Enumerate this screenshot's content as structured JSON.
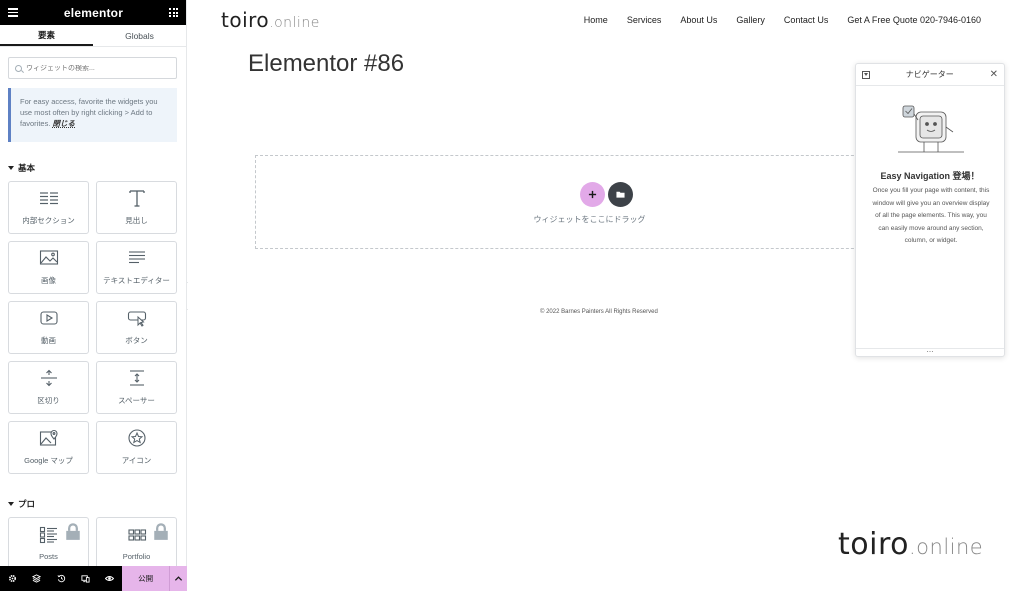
{
  "panel": {
    "brand": "elementor",
    "tabs": [
      "要素",
      "Globals"
    ],
    "search_placeholder": "ウィジェットの検索...",
    "tip": {
      "text": "For easy access, favorite the widgets you use most often by right clicking > Add to favorites.",
      "close_label": "閉じる"
    },
    "basic_section": "基本",
    "basic_widgets": [
      {
        "label": "内部セクション",
        "icon": "inner-section-icon"
      },
      {
        "label": "見出し",
        "icon": "heading-icon"
      },
      {
        "label": "画像",
        "icon": "image-icon"
      },
      {
        "label": "テキストエディター",
        "icon": "text-editor-icon"
      },
      {
        "label": "動画",
        "icon": "video-icon"
      },
      {
        "label": "ボタン",
        "icon": "button-icon"
      },
      {
        "label": "区切り",
        "icon": "divider-icon"
      },
      {
        "label": "スペーサー",
        "icon": "spacer-icon"
      },
      {
        "label": "Google マップ",
        "icon": "google-maps-icon"
      },
      {
        "label": "アイコン",
        "icon": "star-icon"
      }
    ],
    "pro_section": "プロ",
    "pro_widgets": [
      {
        "label": "Posts",
        "icon": "posts-icon",
        "locked": true
      },
      {
        "label": "Portfolio",
        "icon": "portfolio-icon",
        "locked": true
      }
    ],
    "bottom_icons": [
      "settings-icon",
      "layers-icon",
      "history-icon",
      "responsive-icon",
      "preview-icon"
    ],
    "publish_label": "公開",
    "collapse_glyph": "‹"
  },
  "site": {
    "logo_main": "toiro",
    "logo_suffix": ".online",
    "nav": [
      "Home",
      "Services",
      "About Us",
      "Gallery",
      "Contact Us",
      "Get A Free Quote 020-7946-0160"
    ],
    "page_title": "Elementor #86",
    "drop_text": "ウィジェットをここにドラッグ",
    "footer": "© 2022 Barnes Painters All Rights Reserved"
  },
  "navigator": {
    "title": "ナビゲーター",
    "heading": "Easy Navigation 登場！",
    "description": "Once you fill your page with content, this window will give you an overview display of all the page elements. This way, you can easily move around any section, column, or widget.",
    "resize_glyph": "…"
  },
  "colors": {
    "accent_pink": "#e2a9e8",
    "dark": "#000000",
    "tip_border": "#5e81c4"
  }
}
